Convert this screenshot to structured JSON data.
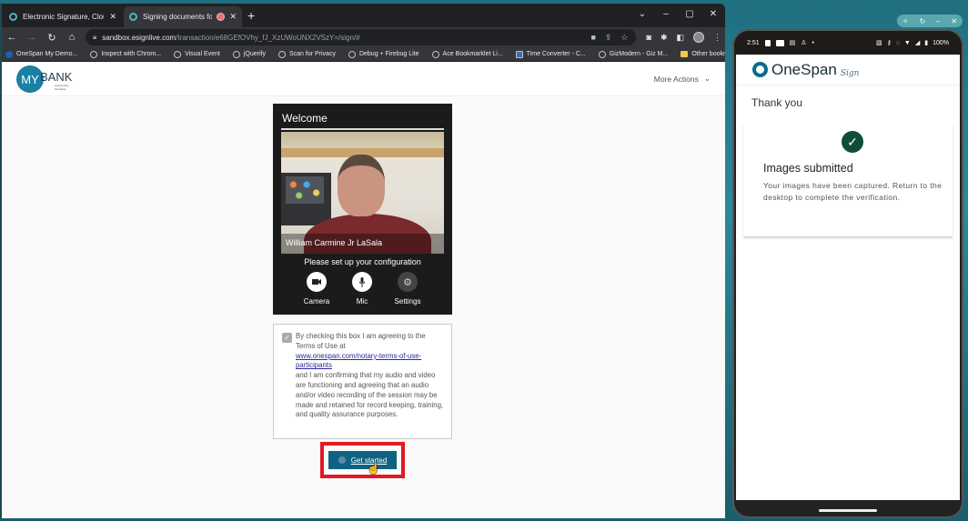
{
  "browser": {
    "tabs": [
      {
        "title": "Electronic Signature, Cloud Auth",
        "active": false
      },
      {
        "title": "Signing documents for Affid",
        "active": true,
        "recording": true
      }
    ],
    "url_host": "sandbox.esignlive.com",
    "url_path": "/transaction/e68GEfOVhy_fJ_XzUWoUNX2VSzY=/sign/#",
    "bookmarks": [
      "OneSpan My Demo...",
      "Inspect with Chrom...",
      "Visual Event",
      "jQuerify",
      "Scan for Privacy",
      "Debug + Firebug Lite",
      "Ace Bookmarklet Li...",
      "Time Converter - C...",
      "GizModern - Giz M..."
    ],
    "other_bookmarks": "Other bookmarks"
  },
  "app": {
    "logo_circle": "MY",
    "logo_text": "BANK",
    "logo_sub": "powered by OneSpan",
    "more_actions": "More Actions",
    "welcome_title": "Welcome",
    "participant_name": "William Carmine Jr LaSala",
    "config_prompt": "Please set up your configuration",
    "controls": {
      "camera": "Camera",
      "mic": "Mic",
      "settings": "Settings"
    },
    "consent": {
      "checked": true,
      "text_before": "By checking this box I am agreeing to the Terms of Use at",
      "link": "www.onespan.com/notary-terms-of-use-participants",
      "text_after": "and I am confirming that my audio and video are functioning and agreeing that an audio and/or video recording of the session may be made and retained for record keeping, training, and quality assurance purposes."
    },
    "get_started": "Get started"
  },
  "phone": {
    "time": "2:51",
    "battery": "100%",
    "brand": "OneSpan",
    "brand_script": "Sign",
    "thank_you": "Thank you",
    "result_title": "Images submitted",
    "result_text": "Your images have been captured. Return to the desktop to complete the verification."
  }
}
